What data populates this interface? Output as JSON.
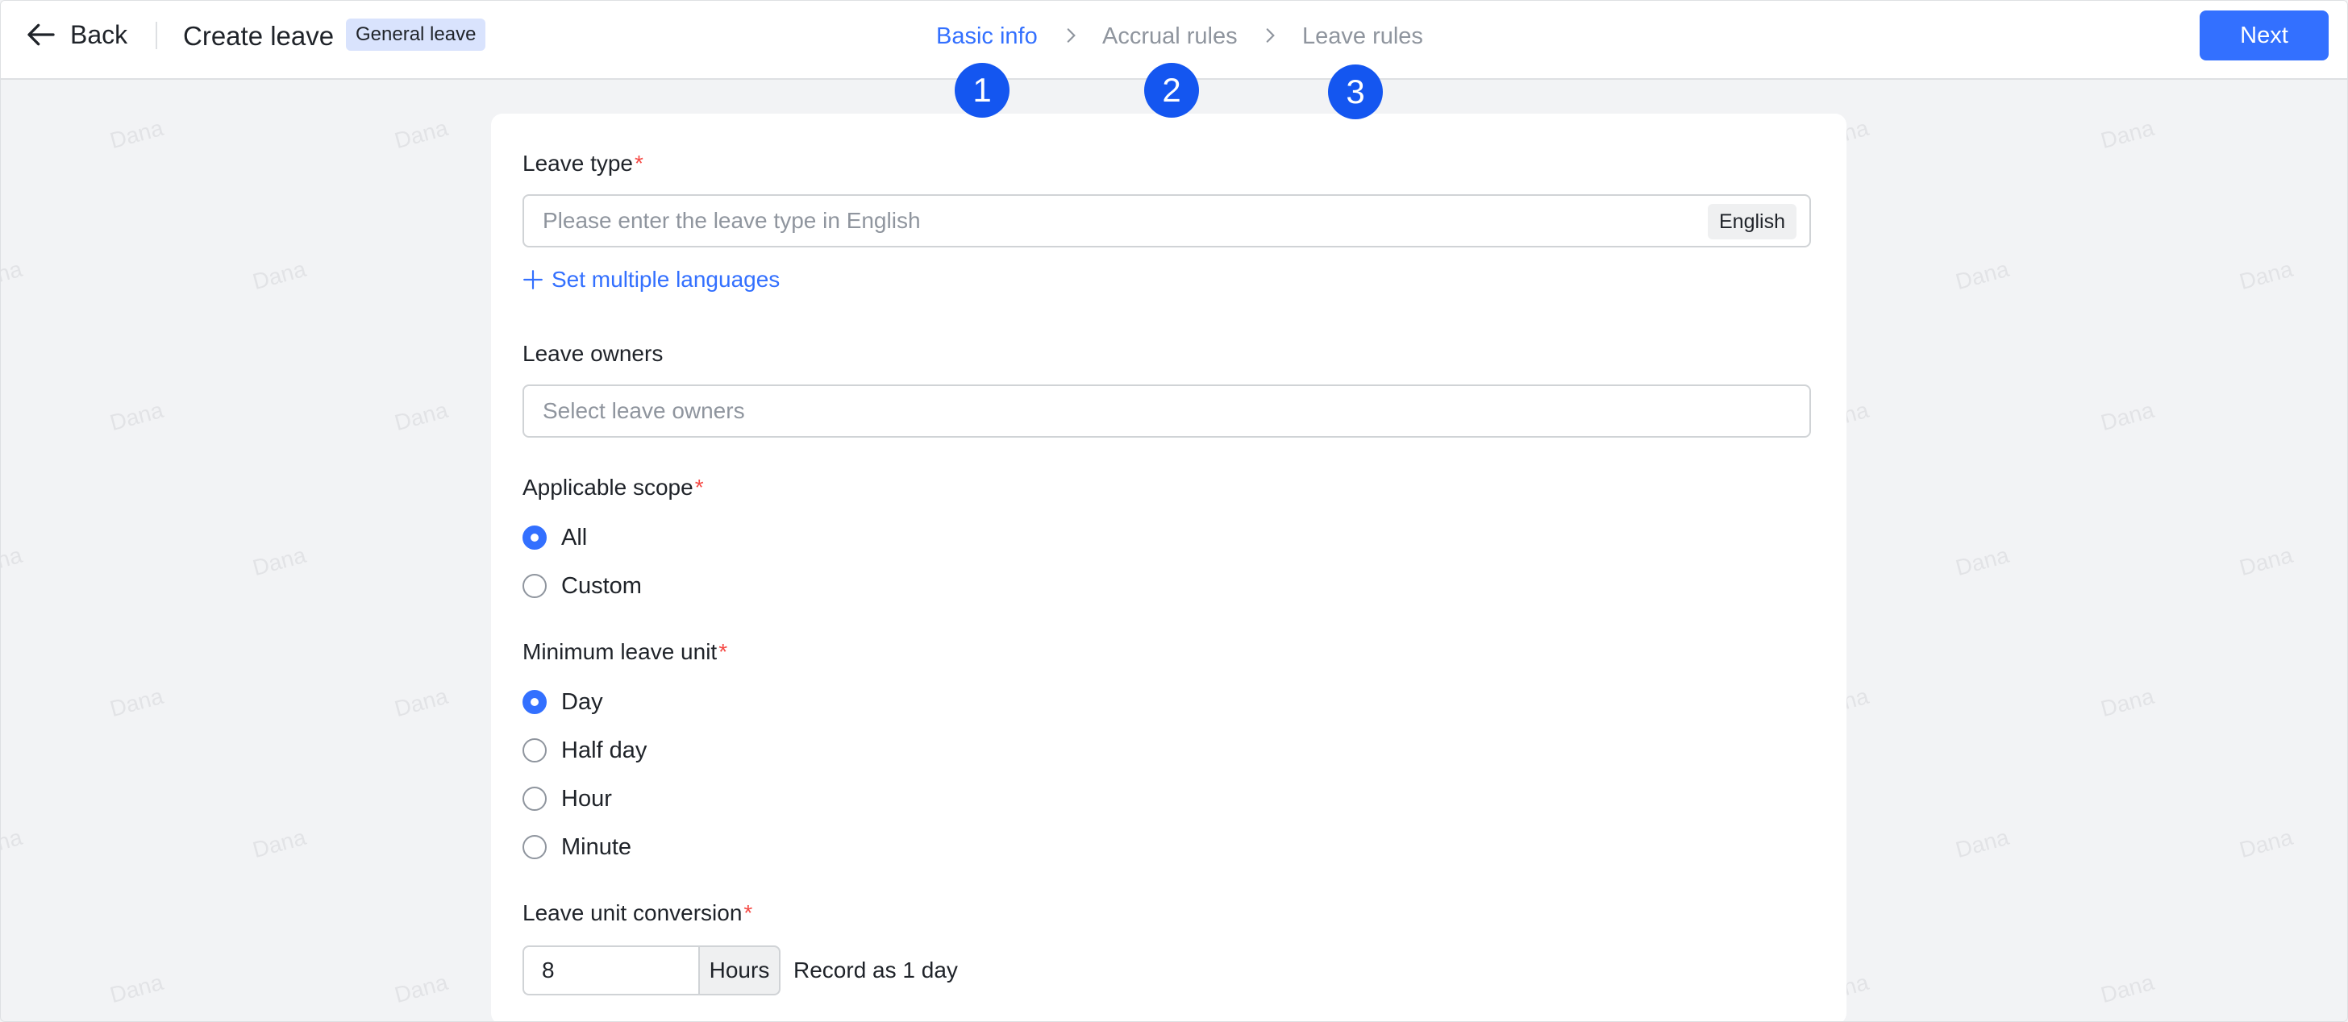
{
  "header": {
    "back_label": "Back",
    "title": "Create leave",
    "tag": "General leave",
    "steps": [
      {
        "label": "Basic info",
        "number": "1",
        "state": "active"
      },
      {
        "label": "Accrual rules",
        "number": "2",
        "state": "inactive"
      },
      {
        "label": "Leave rules",
        "number": "3",
        "state": "inactive"
      }
    ],
    "next_label": "Next"
  },
  "watermark_text": "Dana",
  "form": {
    "leave_type": {
      "label": "Leave type",
      "required_mark": "*",
      "placeholder": "Please enter the leave type in English",
      "language_badge": "English",
      "multi_lang_link": "Set multiple languages"
    },
    "leave_owners": {
      "label": "Leave owners",
      "placeholder": "Select leave owners"
    },
    "applicable_scope": {
      "label": "Applicable scope",
      "required_mark": "*",
      "options": [
        "All",
        "Custom"
      ],
      "selected": "All"
    },
    "minimum_leave_unit": {
      "label": "Minimum leave unit",
      "required_mark": "*",
      "options": [
        "Day",
        "Half day",
        "Hour",
        "Minute"
      ],
      "selected": "Day"
    },
    "leave_unit_conversion": {
      "label": "Leave unit conversion",
      "required_mark": "*",
      "value": "8",
      "unit": "Hours",
      "note": "Record as 1 day"
    }
  },
  "colors": {
    "primary": "#3370ff",
    "step_badge": "#1456f0",
    "required": "#f54a45",
    "tag_bg": "#d9e3fd"
  }
}
